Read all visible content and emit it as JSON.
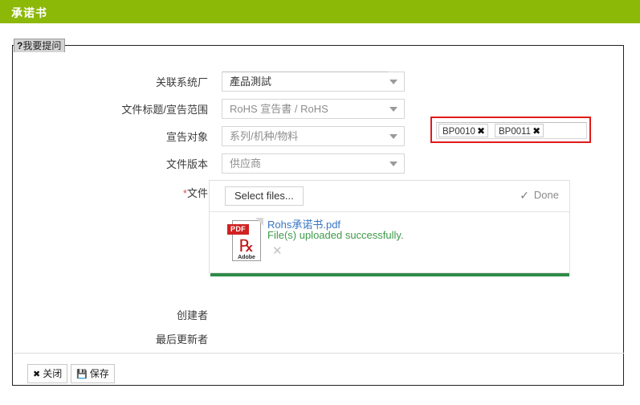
{
  "window": {
    "title": "承诺书",
    "header_color": "#8cb808"
  },
  "tab": {
    "icon": "question-mark",
    "icon_glyph": "?",
    "label": "我要提问"
  },
  "form": {
    "rows": [
      {
        "label": "关联系统厂",
        "required": false,
        "value": "產品測試",
        "control": "select"
      },
      {
        "label": "文件标题/宣告范围",
        "required": false,
        "value": "RoHS 宣告書 / RoHS",
        "control": "select"
      },
      {
        "label": "宣告对象",
        "required": false,
        "value": "系列/机种/物料",
        "control": "select"
      },
      {
        "label": "文件版本",
        "required": false,
        "value": "供应商",
        "control": "select"
      }
    ],
    "file_row": {
      "required_marker": "*",
      "label": "文件"
    },
    "tag_field": {
      "highlight_color": "#e01b1b",
      "tags": [
        {
          "text": "BP0010",
          "remove_glyph": "✖"
        },
        {
          "text": "BP0011",
          "remove_glyph": "✖"
        }
      ]
    }
  },
  "upload": {
    "select_files_label": "Select files...",
    "status_label": "Done",
    "status_check_glyph": "✓",
    "file": {
      "icon": "pdf-file-icon",
      "icon_badge": "PDF",
      "icon_brand": "Adobe",
      "name": "Rohs承诺书.pdf",
      "status_text": "File(s) uploaded successfully.",
      "status_color": "#3f9a4a",
      "remove_glyph": "✕"
    },
    "progress_color": "#2e8b48",
    "progress_percent": 100
  },
  "meta": {
    "creator_label": "创建者",
    "creator_value": "",
    "last_updater_label": "最后更新者",
    "last_updater_value": ""
  },
  "footer": {
    "close_button": {
      "icon": "close-x-icon",
      "icon_glyph": "✖",
      "label": "关闭"
    },
    "save_button": {
      "icon": "floppy-disk-icon",
      "icon_glyph": "💾",
      "label": "保存"
    }
  }
}
